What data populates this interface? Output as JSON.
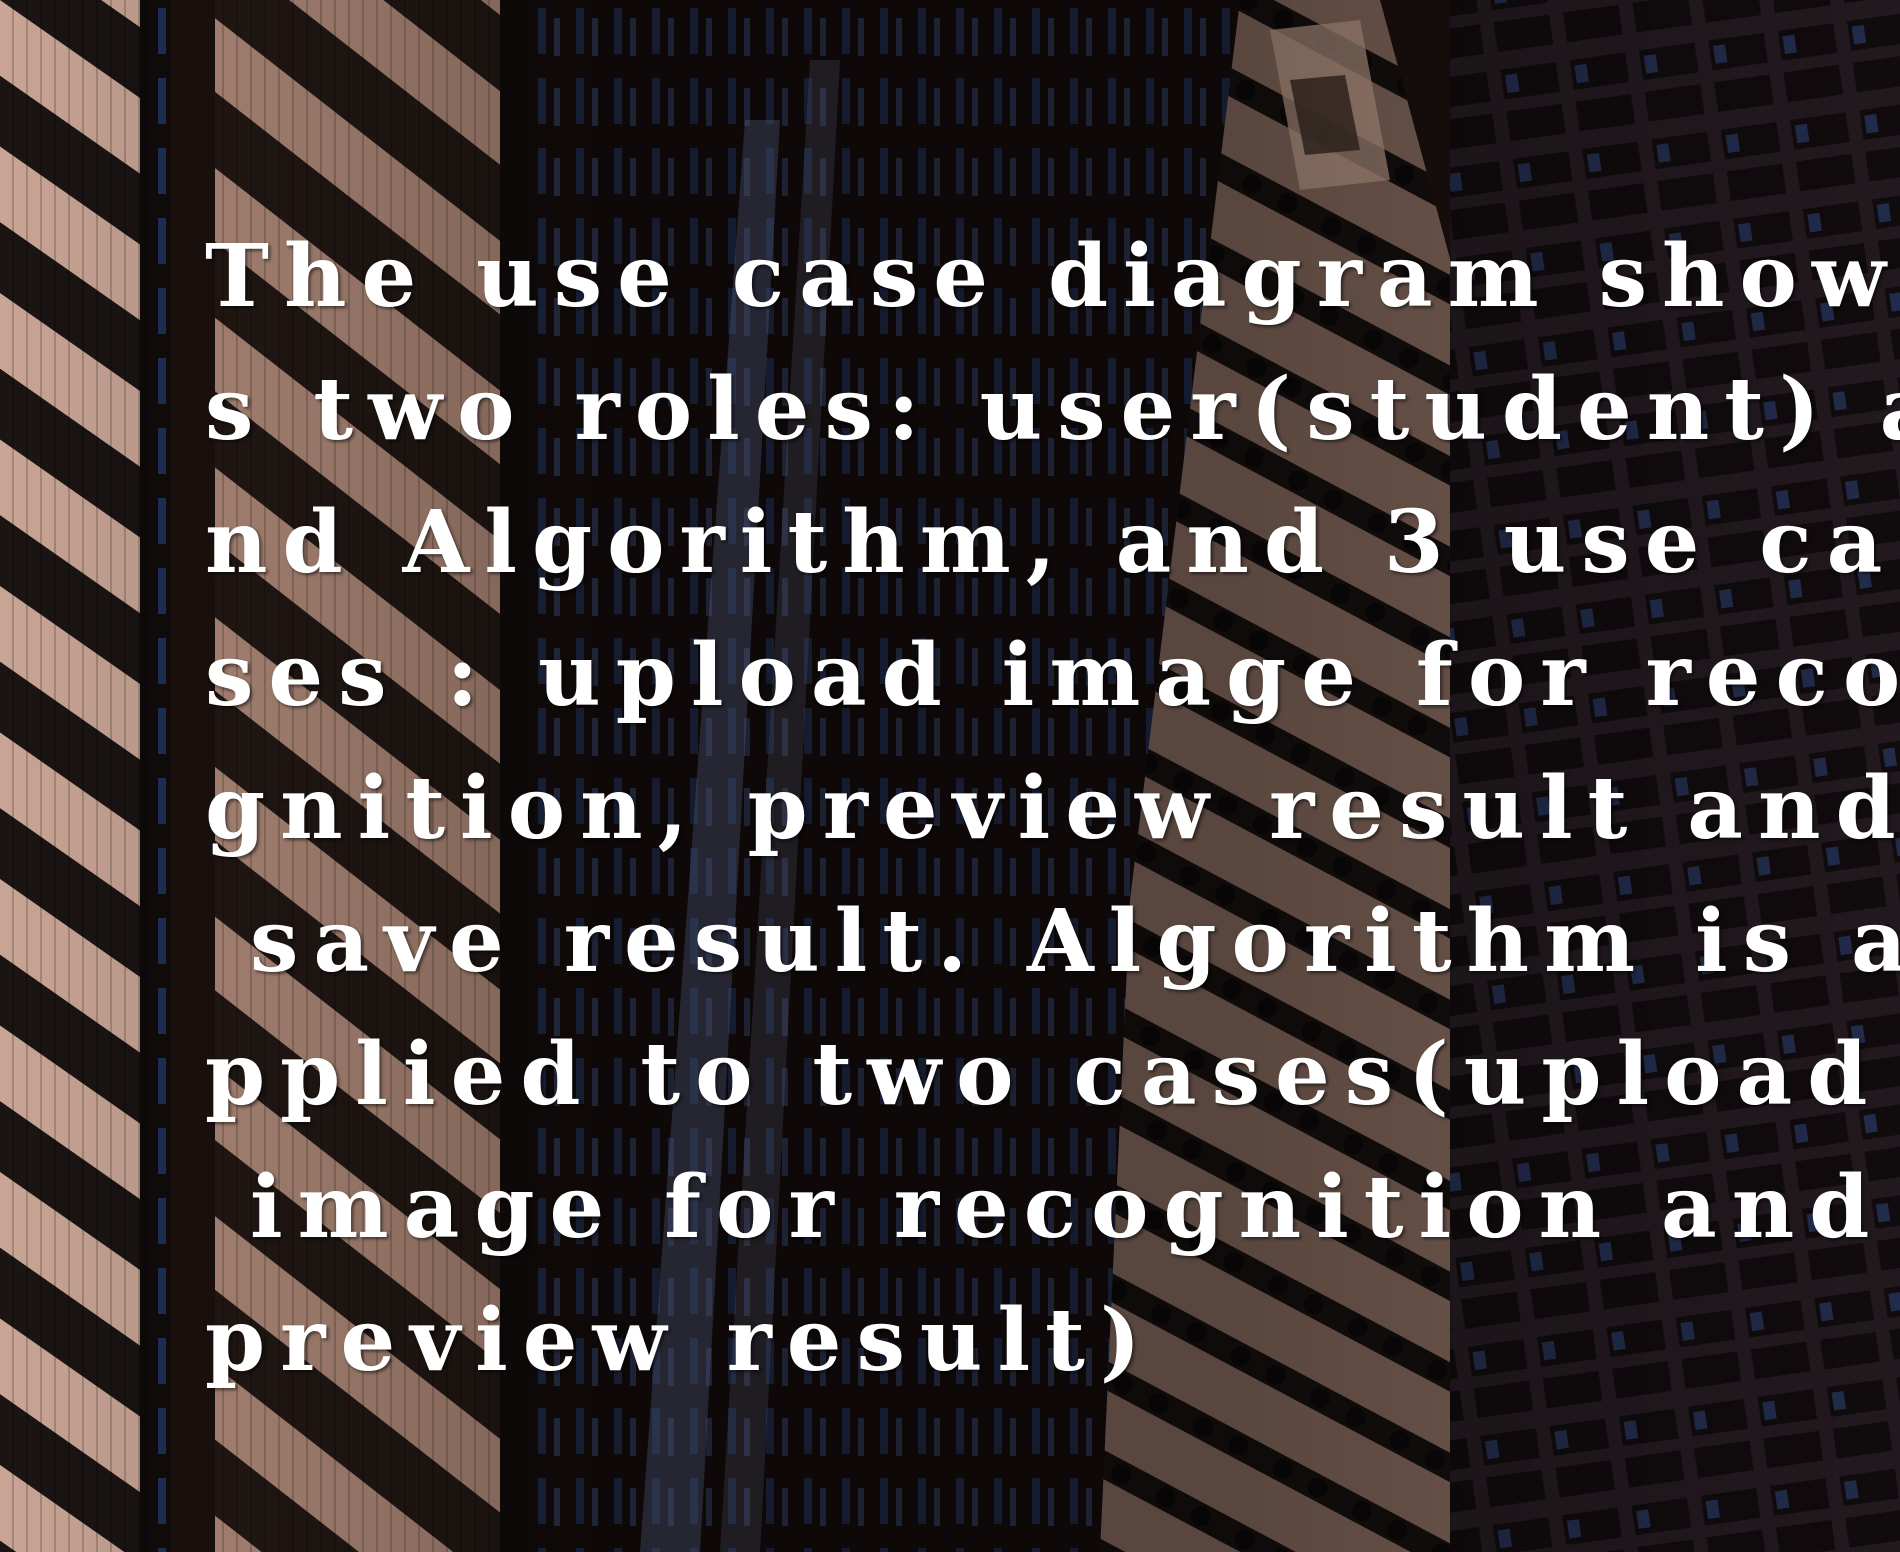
{
  "background": {
    "description_colors": {
      "dark": "#1c120f",
      "tan": "#c7a08e",
      "stripe": "#e4c4b2",
      "window_blue": "#2f5aa8",
      "glow_blue": "#5f8fe8"
    }
  },
  "caption": {
    "lines": [
      "The use case diagram show",
      "s two roles: user(student) a",
      "nd Algorithm, and 3 use ca",
      "ses : upload image for reco",
      "gnition, preview result and",
      " save result. Algorithm is a",
      "pplied to two cases(upload",
      " image for recognition and",
      "preview result)"
    ]
  }
}
